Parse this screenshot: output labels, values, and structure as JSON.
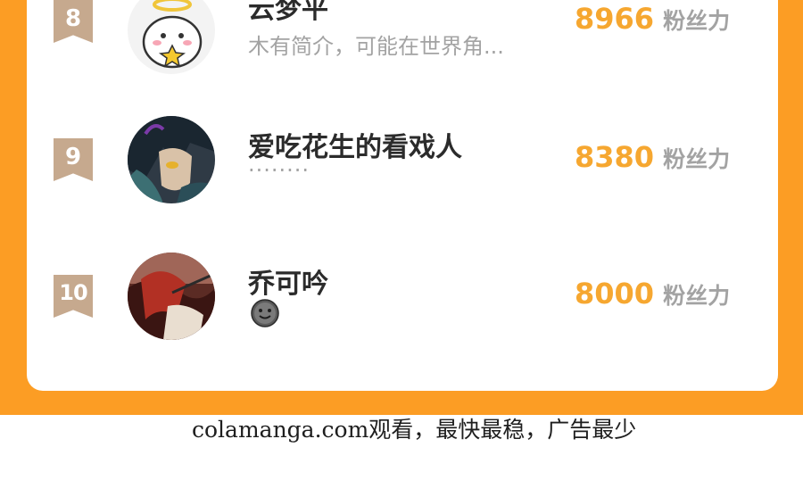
{
  "ranking": [
    {
      "rank": "8",
      "name": "云梦平",
      "bio": "木有简介，可能在世界角...",
      "fans_count": "8966",
      "fans_unit": "粉丝力",
      "avatar": "angel-cartoon-avatar"
    },
    {
      "rank": "9",
      "name": "爱吃花生的看戏人",
      "bio": "........",
      "fans_count": "8380",
      "fans_unit": "粉丝力",
      "avatar": "dark-haired-character-avatar"
    },
    {
      "rank": "10",
      "name": "乔可吟",
      "bio": "",
      "bio_icon": "smiley-emoji-icon",
      "fans_count": "8000",
      "fans_unit": "粉丝力",
      "avatar": "red-haired-character-avatar"
    }
  ],
  "watermark": "colamanga.com观看，最快最稳，广告最少",
  "colors": {
    "frame_orange": "#fc9d24",
    "badge_tan": "#c6a98e",
    "fans_orange": "#f6a730",
    "muted_gray": "#a3a3a3"
  }
}
